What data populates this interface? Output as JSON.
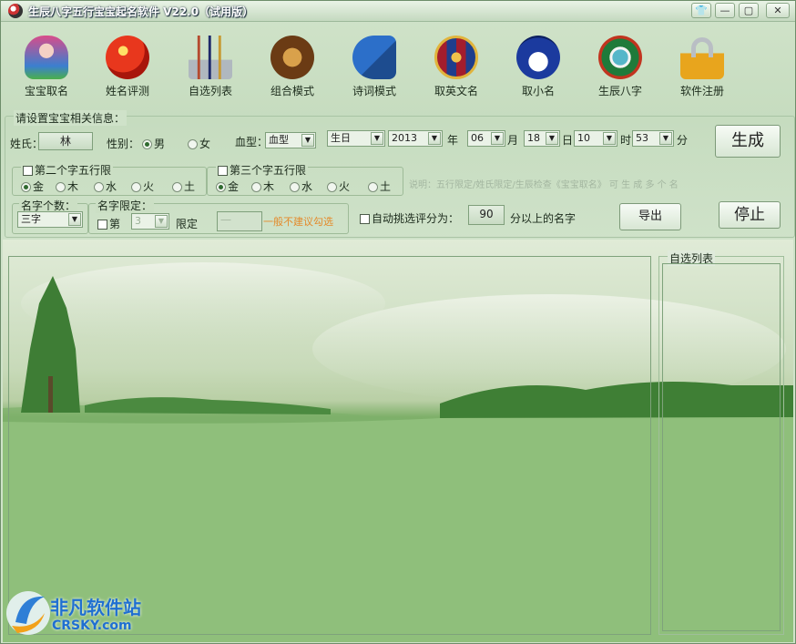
{
  "window": {
    "title": "生辰八字五行宝宝起名软件 V22.0（试用版）",
    "controls": [
      "skin-icon",
      "minimize-icon",
      "maximize-icon",
      "close-icon"
    ]
  },
  "toolbar": {
    "items": [
      {
        "label": "宝宝取名",
        "icon": "baby-doll-icon"
      },
      {
        "label": "姓名评测",
        "icon": "fortune-ball-icon"
      },
      {
        "label": "自选列表",
        "icon": "brush-pot-icon"
      },
      {
        "label": "组合模式",
        "icon": "lion-icon"
      },
      {
        "label": "诗词模式",
        "icon": "poetry-book-icon"
      },
      {
        "label": "取英文名",
        "icon": "crest-icon"
      },
      {
        "label": "取小名",
        "icon": "penguin-icon"
      },
      {
        "label": "生辰八字",
        "icon": "bagua-icon"
      },
      {
        "label": "软件注册",
        "icon": "lock-icon"
      }
    ]
  },
  "form": {
    "section_title": "请设置宝宝相关信息：",
    "surname_label": "姓氏：",
    "surname_value": "林",
    "gender_label": "性别：",
    "gender_options": [
      "男",
      "女"
    ],
    "gender_selected": "男",
    "blood_label": "血型：",
    "blood_value": "血型",
    "date_type": "生日",
    "year": "2013",
    "year_unit": "年",
    "month": "06",
    "month_unit": "月",
    "day": "18",
    "day_unit": "日",
    "hour": "10",
    "hour_unit": "时",
    "minute": "53",
    "minute_unit": "分",
    "generate_label": "生成",
    "second_char_label": "第二个字五行限",
    "third_char_label": "第三个字五行限",
    "elements": [
      "金",
      "木",
      "水",
      "火",
      "土"
    ],
    "element_selected": "金",
    "explanation": "说明：五行限定/姓氏限定/生辰检查《宝宝取名》 可 生 成 多 个 名",
    "name_count_label": "名字个数：",
    "name_count_value": "三字",
    "name_limit_label": "名字限定：",
    "limit_pos_prefix": "第",
    "limit_pos_value": "3",
    "limit_label": "限定",
    "limit_input_value": "一",
    "limit_warning": "一般不建议勾选",
    "auto_pick_label": "自动挑选评分为：",
    "auto_score": "90",
    "auto_suffix": "分以上的名字",
    "export_label": "导出",
    "stop_label": "停止"
  },
  "results": {
    "custom_list_title": "自选列表"
  },
  "watermark": {
    "brand_cn": "非凡软件站",
    "brand_en": "CRSKY.com"
  }
}
